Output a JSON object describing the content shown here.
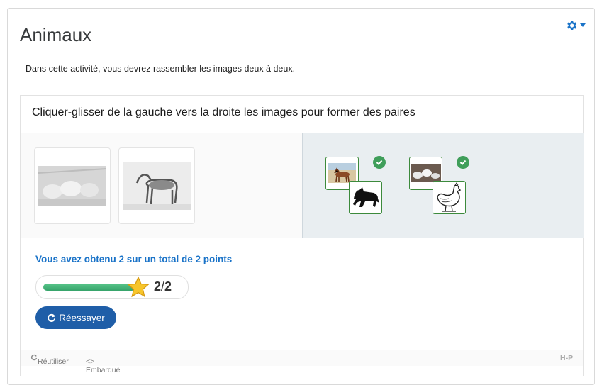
{
  "page": {
    "title": "Animaux",
    "intro": "Dans cette activité, vous devrez rassembler les images deux à deux."
  },
  "activity": {
    "question": "Cliquer-glisser de la gauche vers la droite les images pour former des paires",
    "feedback": "Vous avez obtenu 2 sur un total de 2 points",
    "score": {
      "earned": "2",
      "separator": "/",
      "max": "2",
      "fraction": 1.0
    },
    "retry_label": "Réessayer",
    "source_cards": [
      {
        "icon": "chickens-image"
      },
      {
        "icon": "horse-image"
      }
    ],
    "pairs": [
      {
        "top": "horse-photo",
        "bottom": "horse-silhouette",
        "status": "correct"
      },
      {
        "top": "chickens-photo",
        "bottom": "rooster-drawing",
        "status": "correct"
      }
    ]
  },
  "footer": {
    "reuse": "Réutiliser",
    "embed": "<> Embarqué",
    "brand": "H-P"
  },
  "colors": {
    "accent": "#1a73c8",
    "check": "#3f9e5a",
    "button": "#1f5ea8",
    "progress": "#3fb67a"
  }
}
